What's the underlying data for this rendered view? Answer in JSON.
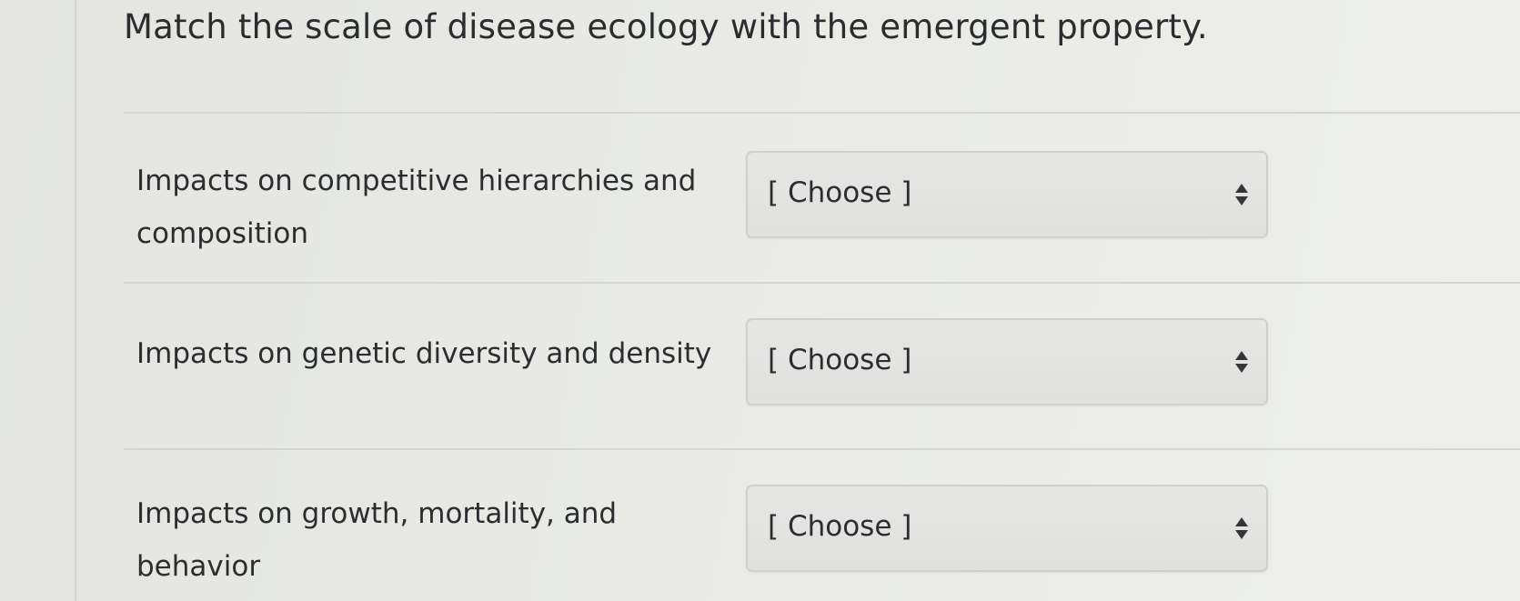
{
  "question": "Match the scale of disease ecology with the emergent property.",
  "rows": [
    {
      "label_line1": "Impacts on competitive hierarchies and",
      "label_line2": "composition",
      "select_value": "[ Choose ]"
    },
    {
      "label_line1": "Impacts on genetic diversity and density",
      "label_line2": "",
      "select_value": "[ Choose ]"
    },
    {
      "label_line1": "Impacts on growth, mortality, and",
      "label_line2": "behavior",
      "select_value": "[ Choose ]"
    }
  ],
  "icons": {
    "select_arrows": "up-down-chevron-icon"
  }
}
